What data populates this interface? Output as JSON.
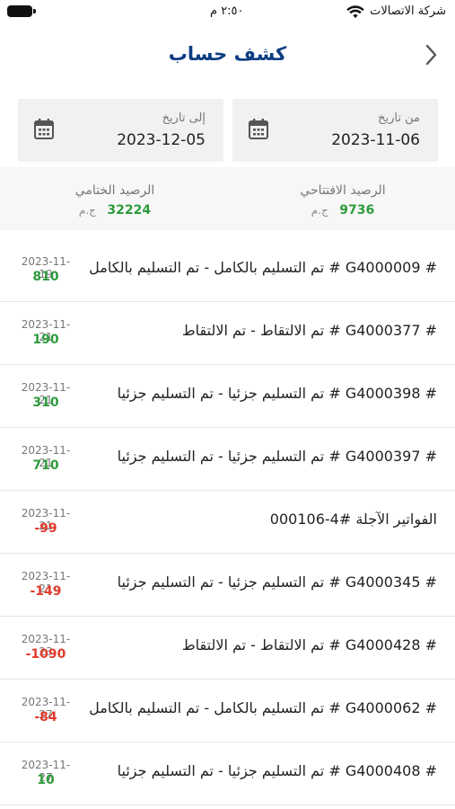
{
  "status": {
    "carrier": "شركة الاتصالات",
    "time": "٢:٥٠ م"
  },
  "header": {
    "title": "كشف حساب"
  },
  "filters": {
    "from_label": "من تاريخ",
    "from_value": "2023-11-06",
    "to_label": "إلى تاريخ",
    "to_value": "2023-12-05"
  },
  "balances": {
    "opening_label": "الرصيد الافتتاحي",
    "opening_amount": "9736",
    "closing_label": "الرصيد الختامي",
    "closing_amount": "32224",
    "currency": "ج.م"
  },
  "transactions": [
    {
      "desc": "# G4000009 # تم التسليم بالكامل - تم التسليم بالكامل",
      "date": "2023-11-19",
      "amount": "810",
      "sign": "pos"
    },
    {
      "desc": "# G4000377 # تم الالتقاط - تم الالتقاط",
      "date": "2023-11-21",
      "amount": "190",
      "sign": "pos"
    },
    {
      "desc": "# G4000398 # تم التسليم جزئيا - تم التسليم جزئيا",
      "date": "2023-11-21",
      "amount": "310",
      "sign": "pos"
    },
    {
      "desc": "# G4000397 # تم التسليم جزئيا - تم التسليم جزئيا",
      "date": "2023-11-21",
      "amount": "710",
      "sign": "pos"
    },
    {
      "desc": "الفواتير الآجلة #4-000106",
      "date": "2023-11-21",
      "amount": "-99",
      "sign": "neg"
    },
    {
      "desc": "# G4000345 # تم التسليم جزئيا - تم التسليم جزئيا",
      "date": "2023-11-21",
      "amount": "-149",
      "sign": "neg"
    },
    {
      "desc": "# G4000428 # تم الالتقاط - تم الالتقاط",
      "date": "2023-11-23",
      "amount": "-1090",
      "sign": "neg"
    },
    {
      "desc": "# G4000062 # تم التسليم بالكامل - تم التسليم بالكامل",
      "date": "2023-11-27",
      "amount": "-84",
      "sign": "neg"
    },
    {
      "desc": "# G4000408 # تم التسليم جزئيا - تم التسليم جزئيا",
      "date": "2023-11-27",
      "amount": "10",
      "sign": "pos"
    }
  ],
  "icons": {
    "back": "chevron-back-icon",
    "calendar": "calendar-icon",
    "wifi": "wifi-icon",
    "battery": "battery-icon"
  },
  "colors": {
    "title": "#0d3d82",
    "positive": "#2e9b3d",
    "negative": "#e03b2c"
  }
}
